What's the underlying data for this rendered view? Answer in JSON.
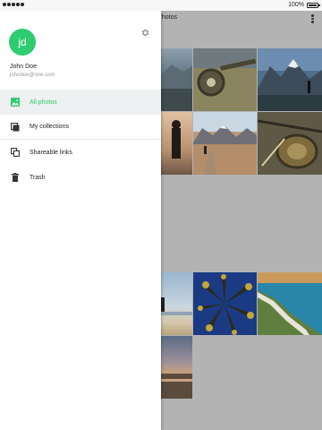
{
  "status_bar": {
    "battery_text": "100%"
  },
  "app": {
    "title": "hotos"
  },
  "drawer": {
    "avatar_initials": "jd",
    "user_name": "John Doe",
    "user_email": "johndoe@one.com",
    "items": [
      {
        "label": "All photos",
        "icon": "photo-icon",
        "active": true
      },
      {
        "label": "My collections",
        "icon": "collections-icon",
        "active": false
      },
      {
        "label": "Shareable links",
        "icon": "share-links-icon",
        "active": false
      },
      {
        "label": "Trash",
        "icon": "trash-icon",
        "active": false
      }
    ]
  },
  "colors": {
    "accent": "#2ecc71",
    "scrim": "#b3b3b3",
    "drawer_bg": "#ffffff"
  },
  "photos": [
    {
      "name": "photo-coast-road"
    },
    {
      "name": "photo-fishing-reel"
    },
    {
      "name": "photo-mountain-lake"
    },
    {
      "name": "photo-silhouette"
    },
    {
      "name": "photo-desert-mountains"
    },
    {
      "name": "photo-fly-fishing-gear"
    },
    {
      "name": "photo-beach-person"
    },
    {
      "name": "photo-palm-trees"
    },
    {
      "name": "photo-aerial-coast"
    },
    {
      "name": "photo-sunset-beach"
    }
  ]
}
